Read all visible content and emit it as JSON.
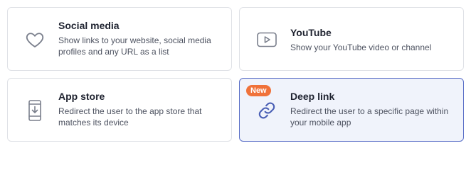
{
  "colors": {
    "icon": "#7a7f8c",
    "icon_active": "#4a5fb5",
    "badge": "#f0723a",
    "selected_border": "#5a6fc7",
    "selected_bg": "#f0f3fb"
  },
  "cards": [
    {
      "icon": "heart-icon",
      "title": "Social media",
      "description": "Show links to your website, social media profiles and any URL as a list"
    },
    {
      "icon": "youtube-play-icon",
      "title": "YouTube",
      "description": "Show your YouTube video or channel"
    },
    {
      "icon": "mobile-download-icon",
      "title": "App store",
      "description": "Redirect the user to the app store that matches its device"
    },
    {
      "icon": "link-icon",
      "badge": "New",
      "title": "Deep link",
      "description": "Redirect the user to a specific page within your mobile app",
      "selected": true
    }
  ]
}
